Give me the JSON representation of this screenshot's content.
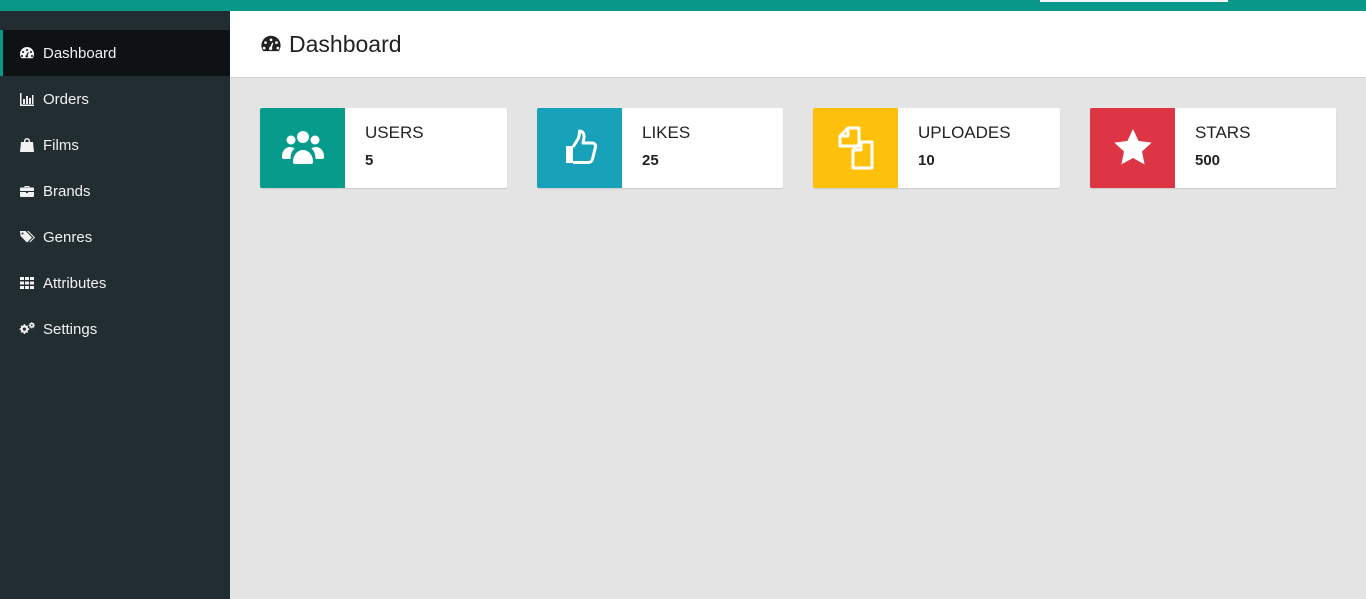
{
  "sidebar": {
    "items": [
      {
        "label": "Dashboard",
        "icon": "dashboard-icon"
      },
      {
        "label": "Orders",
        "icon": "bar-chart-icon"
      },
      {
        "label": "Films",
        "icon": "shopping-bag-icon"
      },
      {
        "label": "Brands",
        "icon": "briefcase-icon"
      },
      {
        "label": "Genres",
        "icon": "tags-icon"
      },
      {
        "label": "Attributes",
        "icon": "grid-icon"
      },
      {
        "label": "Settings",
        "icon": "cogs-icon"
      }
    ]
  },
  "header": {
    "title": "Dashboard",
    "icon": "dashboard-icon"
  },
  "stats": [
    {
      "label": "USERS",
      "value": "5",
      "icon": "users-icon",
      "color": "#079b8b"
    },
    {
      "label": "LIKES",
      "value": "25",
      "icon": "thumbs-up-icon",
      "color": "#18a2b9"
    },
    {
      "label": "UPLOADES",
      "value": "10",
      "icon": "files-icon",
      "color": "#fdc10b"
    },
    {
      "label": "STARS",
      "value": "500",
      "icon": "star-icon",
      "color": "#dd3546"
    }
  ],
  "colors": {
    "topbar": "#07988a",
    "sidebar": "#222d32",
    "background": "#e4e4e4"
  }
}
